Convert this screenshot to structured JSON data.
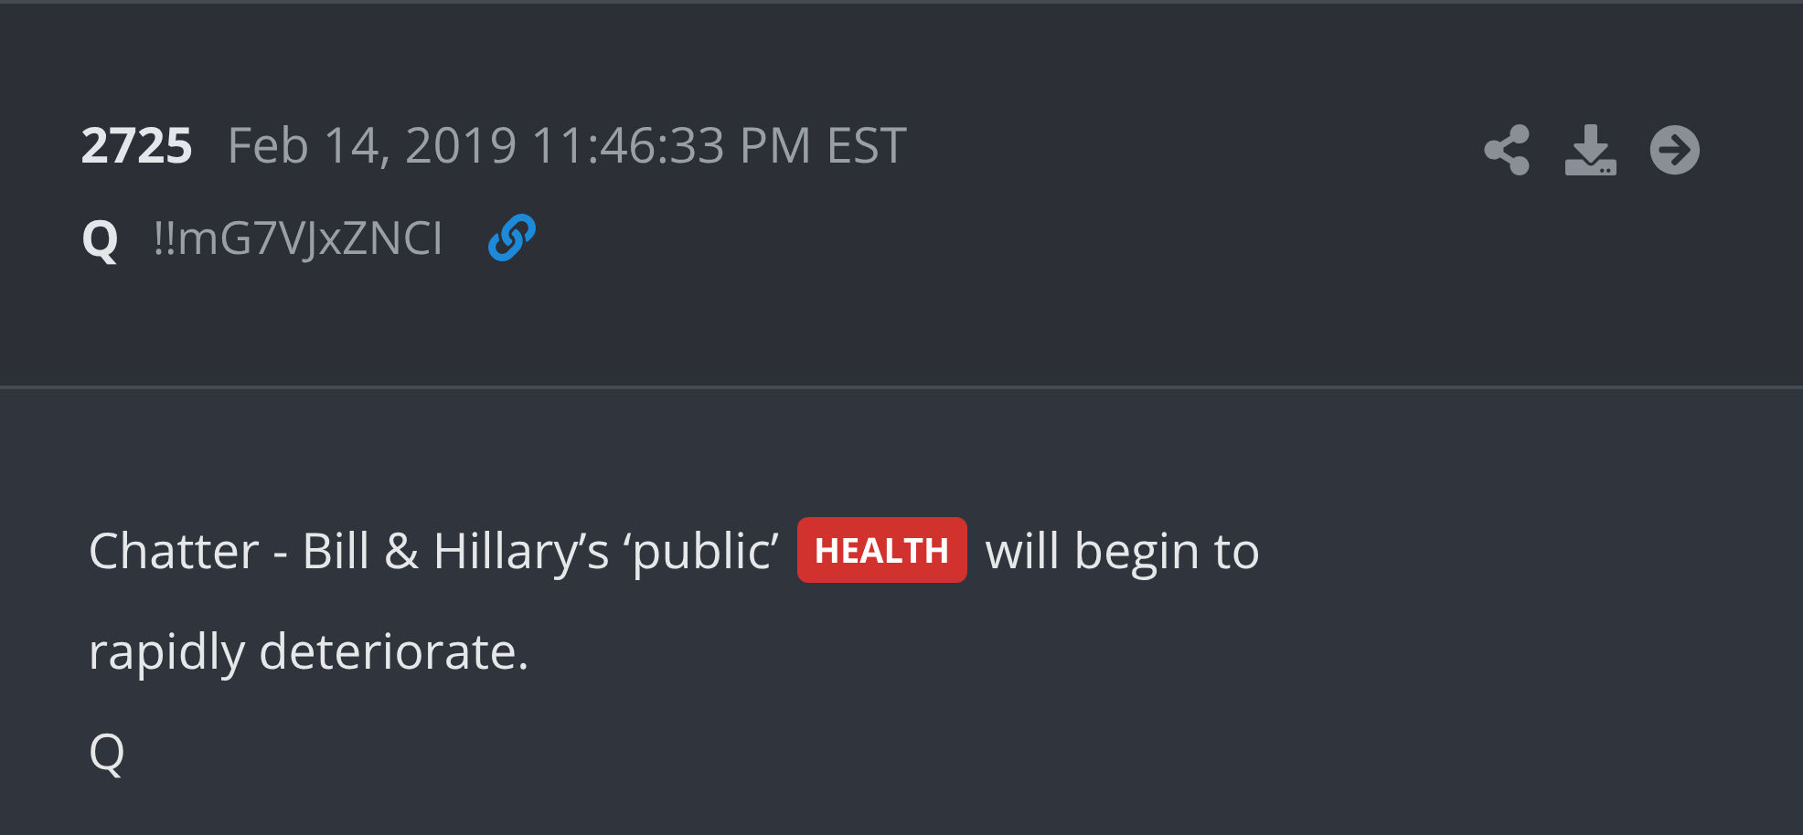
{
  "post": {
    "number": "2725",
    "timestamp": "Feb 14, 2019 11:46:33 PM EST",
    "author": "Q",
    "tripcode": "!!mG7VJxZNCI"
  },
  "body": [
    {
      "segments": [
        {
          "kind": "text",
          "text": "Chatter - Bill & Hillary’s ‘public’"
        },
        {
          "kind": "tag",
          "text": "HEALTH"
        },
        {
          "kind": "text",
          "text": "will begin to"
        }
      ]
    },
    {
      "segments": [
        {
          "kind": "text",
          "text": "rapidly deteriorate."
        }
      ]
    },
    {
      "segments": [
        {
          "kind": "text",
          "text": "Q"
        }
      ]
    }
  ]
}
